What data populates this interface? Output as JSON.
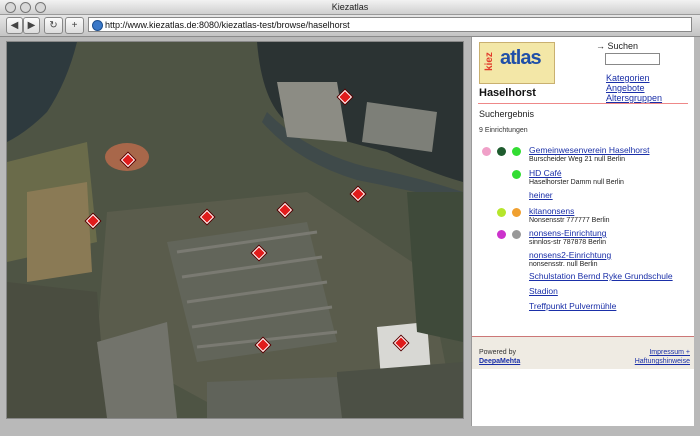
{
  "window": {
    "title": "Kiezatlas"
  },
  "toolbar": {
    "back_icon": "back-arrow-icon",
    "forward_icon": "forward-arrow-icon",
    "reload_icon": "reload-icon",
    "add_icon": "plus-icon",
    "url": "http://www.kiezatlas.de:8080/kiezatlas-test/browse/haselhorst"
  },
  "logo": {
    "kiez": "kiez",
    "atlas": "atlas"
  },
  "search": {
    "label": "Suchen",
    "value": ""
  },
  "nav": {
    "kategorien": "Kategorien",
    "angebote": "Angebote",
    "altersgruppen": "Altersgruppen"
  },
  "place": "Haselhorst",
  "results": {
    "title": "Suchergebnis",
    "count": "9 Einrichtungen",
    "entries": [
      {
        "name": "Gemeinwesenverein Haselhorst",
        "address": "Burscheider Weg 21     null Berlin",
        "dots": [
          "#f0a0c8",
          "#1e5c2e",
          "#33dd33"
        ]
      },
      {
        "name": "HD Café",
        "address": "Haselhorster Damm     null Berlin",
        "dots": [
          "#33dd33"
        ]
      },
      {
        "name": "heiner",
        "address": "",
        "dots": []
      },
      {
        "name": "kitanonsens",
        "address": "Nonsensstr     777777 Berlin",
        "dots": [
          "#b6e62c",
          "#f0a030"
        ]
      },
      {
        "name": "nonsens-Einrichtung",
        "address": "sinnlos-str     787878 Berlin",
        "dots": [
          "#cc33cc",
          "#999999"
        ]
      },
      {
        "name": "nonsens2-Einrichtung",
        "address": "nonsensstr.     null Berlin",
        "dots": []
      },
      {
        "name": "Schulstation Bernd Ryke Grundschule",
        "address": "",
        "dots": []
      },
      {
        "name": "Stadion",
        "address": "",
        "dots": []
      },
      {
        "name": "Treffpunkt Pulvermühle",
        "address": "",
        "dots": []
      }
    ]
  },
  "footer": {
    "powered": "Powered by",
    "deepamehta": "DeepaMehta",
    "impressum": "Impressum +",
    "haftung": "Haftungshinweise"
  },
  "map": {
    "pin_color": "#e01c1c",
    "pin_count": 9
  }
}
